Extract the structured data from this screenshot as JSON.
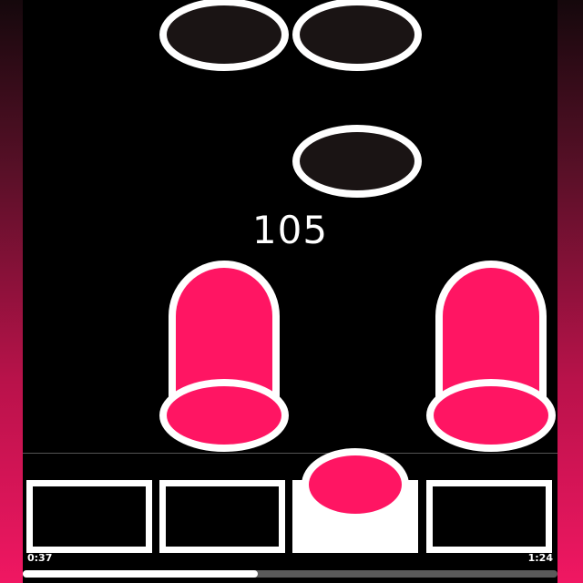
{
  "score": "105",
  "time": {
    "elapsed": "0:37",
    "total": "1:24"
  },
  "progress": {
    "fraction": 0.44
  },
  "lanes": [
    {
      "active": false
    },
    {
      "active": false
    },
    {
      "active": true
    },
    {
      "active": false
    }
  ],
  "colors": {
    "accent": "#ff1563",
    "note_dark": "#1a1414",
    "outline": "#ffffff"
  }
}
